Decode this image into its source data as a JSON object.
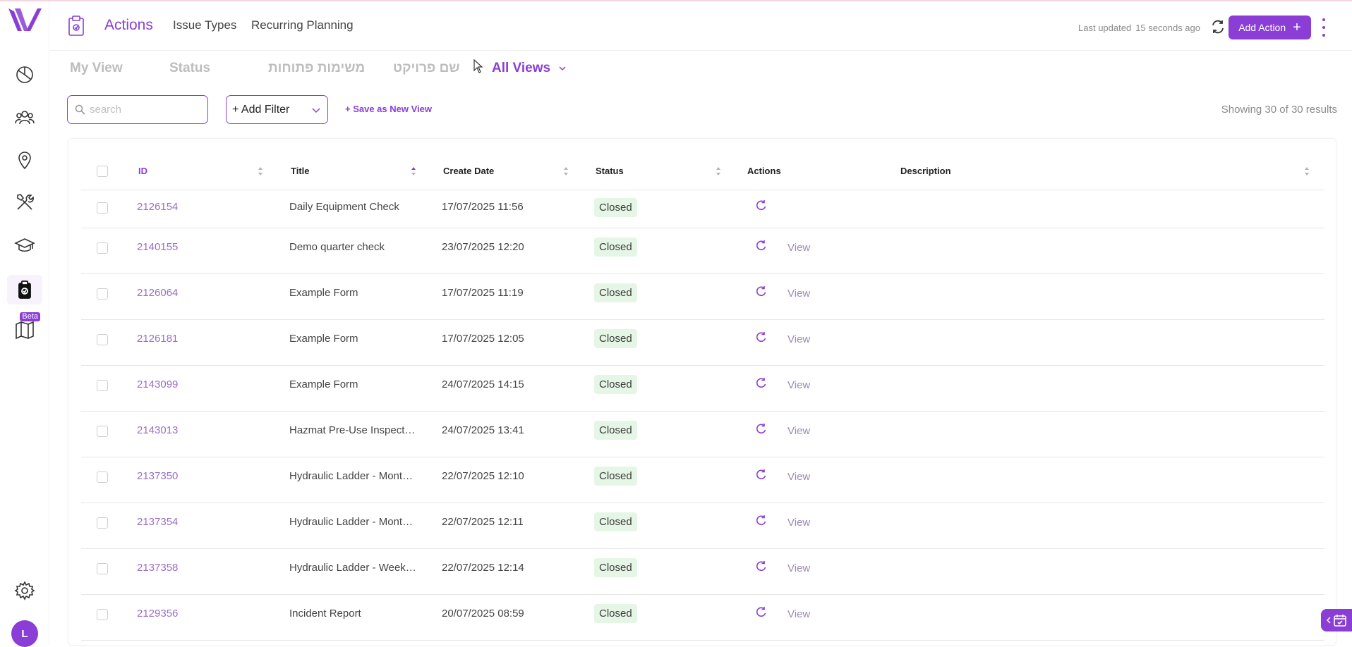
{
  "colors": {
    "accent": "#8a3ed6",
    "closed_badge_bg": "#e6f6e6",
    "muted_text": "#8a8a8a"
  },
  "sidebar": {
    "items": [
      {
        "name": "dashboard-icon"
      },
      {
        "name": "users-icon"
      },
      {
        "name": "location-pin-icon"
      },
      {
        "name": "tools-icon"
      },
      {
        "name": "graduation-cap-icon"
      },
      {
        "name": "clipboard-check-icon",
        "active": true
      },
      {
        "name": "map-icon",
        "badge": "Beta"
      }
    ],
    "settings_icon": "gear-icon",
    "avatar_initial": "L"
  },
  "header": {
    "tabs": [
      "Actions",
      "Issue Types",
      "Recurring Planning"
    ],
    "active_tab": "Actions",
    "last_updated_label": "Last updated",
    "last_updated_value": "15 seconds ago",
    "add_action_label": "Add Action"
  },
  "views": {
    "tabs": [
      "My View",
      "Status",
      "משימות פתוחות",
      "שם פרויקט"
    ],
    "all_views_label": "All Views"
  },
  "toolbar": {
    "search_placeholder": "search",
    "add_filter_label": "+ Add Filter",
    "save_view_label": "+ Save as New View",
    "showing_text": "Showing 30 of 30 results"
  },
  "table": {
    "columns": [
      "ID",
      "Title",
      "Create Date",
      "Status",
      "Actions",
      "Description"
    ],
    "view_label": "View",
    "rows": [
      {
        "id": "2126154",
        "title": "Daily Equipment Check",
        "date": "17/07/2025 11:56",
        "status": "Closed",
        "view": false
      },
      {
        "id": "2140155",
        "title": "Demo quarter check",
        "date": "23/07/2025 12:20",
        "status": "Closed",
        "view": true
      },
      {
        "id": "2126064",
        "title": "Example Form",
        "date": "17/07/2025 11:19",
        "status": "Closed",
        "view": true
      },
      {
        "id": "2126181",
        "title": "Example Form",
        "date": "17/07/2025 12:05",
        "status": "Closed",
        "view": true
      },
      {
        "id": "2143099",
        "title": "Example Form",
        "date": "24/07/2025 14:15",
        "status": "Closed",
        "view": true
      },
      {
        "id": "2143013",
        "title": "Hazmat Pre-Use Inspection",
        "date": "24/07/2025 13:41",
        "status": "Closed",
        "view": true
      },
      {
        "id": "2137350",
        "title": "Hydraulic Ladder - Mont…",
        "date": "22/07/2025 12:10",
        "status": "Closed",
        "view": true
      },
      {
        "id": "2137354",
        "title": "Hydraulic Ladder - Mont…",
        "date": "22/07/2025 12:11",
        "status": "Closed",
        "view": true
      },
      {
        "id": "2137358",
        "title": "Hydraulic Ladder - Weekl…",
        "date": "22/07/2025 12:14",
        "status": "Closed",
        "view": true
      },
      {
        "id": "2129356",
        "title": "Incident Report",
        "date": "20/07/2025 08:59",
        "status": "Closed",
        "view": true
      }
    ]
  }
}
